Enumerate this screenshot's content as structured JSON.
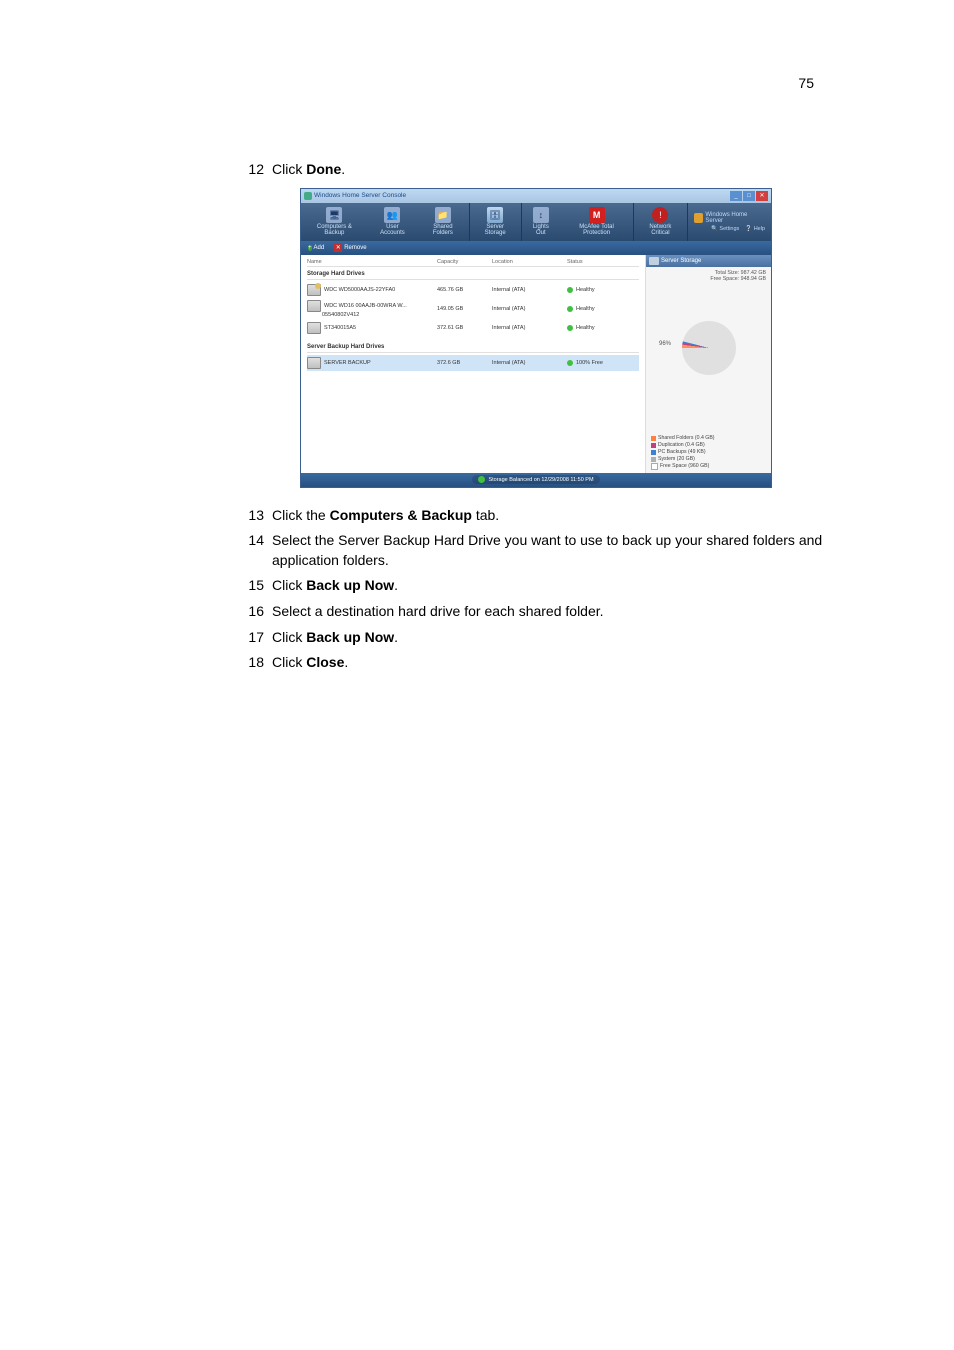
{
  "page_number": "75",
  "step12_num": "12",
  "step12_a": "Click ",
  "step12_b": "Done",
  "step12_c": ".",
  "step13_num": "13",
  "step13_a": "Click the ",
  "step13_b": "Computers & Backup",
  "step13_c": " tab.",
  "step14_num": "14",
  "step14": "Select the Server Backup Hard Drive you want to use to back up your shared folders and application folders.",
  "step15_num": "15",
  "step15_a": "Click ",
  "step15_b": "Back up Now",
  "step15_c": ".",
  "step16_num": "16",
  "step16": "Select a destination hard drive for each shared folder.",
  "step17_num": "17",
  "step17_a": "Click ",
  "step17_b": "Back up Now",
  "step17_c": ".",
  "step18_num": "18",
  "step18_a": "Click ",
  "step18_b": "Close",
  "step18_c": ".",
  "window": {
    "title": "Windows Home Server Console",
    "toolbar": {
      "computers": "Computers\n& Backup",
      "users": "User\nAccounts",
      "shared": "Shared\nFolders",
      "storage": "Server\nStorage",
      "lights": "Lights\nOut",
      "mcafee": "McAfee Total\nProtection",
      "network": "Network\nCritical"
    },
    "brand": "Windows Home Server",
    "link_settings": "Settings",
    "link_help": "Help",
    "action_add": "Add",
    "action_remove": "Remove",
    "columns": {
      "name": "Name",
      "capacity": "Capacity",
      "location": "Location",
      "status": "Status"
    },
    "section_storage": "Storage Hard Drives",
    "section_backup": "Server Backup Hard Drives",
    "drives": [
      {
        "name": "WDC WD5000AAJS-22YFA0",
        "cap": "465.76 GB",
        "loc": "Internal (ATA)",
        "status": "Healthy"
      },
      {
        "name": "WDC WD16 00AAJB-00WRA W...",
        "cap": "149.05 GB",
        "loc": "Internal (ATA)",
        "status": "Healthy"
      },
      {
        "name": "05540802V412",
        "cap": "",
        "loc": "",
        "status": ""
      },
      {
        "name": "ST340015A5",
        "cap": "372.61 GB",
        "loc": "Internal (ATA)",
        "status": "Healthy"
      }
    ],
    "backup_drive": {
      "name": "SERVER BACKUP",
      "cap": "372.6 GB",
      "loc": "Internal (ATA)",
      "status": "100% Free"
    },
    "side": {
      "header": "Server Storage",
      "total": "Total Size: 987.42 GB",
      "free": "Free Space: 948.94 GB",
      "pct": "96%",
      "legend": [
        "Shared Folders (0.4 GB)",
        "Duplication (0.4 GB)",
        "PC Backups (49 KB)",
        "System (20 GB)",
        "Free Space (960 GB)"
      ]
    },
    "statusbar": "Storage Balanced on 12/29/2008 11:50 PM"
  },
  "chart_data": {
    "type": "pie",
    "title": "Server Storage usage",
    "series": [
      {
        "name": "Shared Folders",
        "value": 0.4,
        "unit": "GB"
      },
      {
        "name": "Duplication",
        "value": 0.4,
        "unit": "GB"
      },
      {
        "name": "PC Backups",
        "value": 4.9e-05,
        "unit": "GB"
      },
      {
        "name": "System",
        "value": 20,
        "unit": "GB"
      },
      {
        "name": "Free Space",
        "value": 960,
        "unit": "GB"
      }
    ],
    "total_size_gb": 987.42,
    "free_space_gb": 948.94,
    "free_percent": 96
  }
}
